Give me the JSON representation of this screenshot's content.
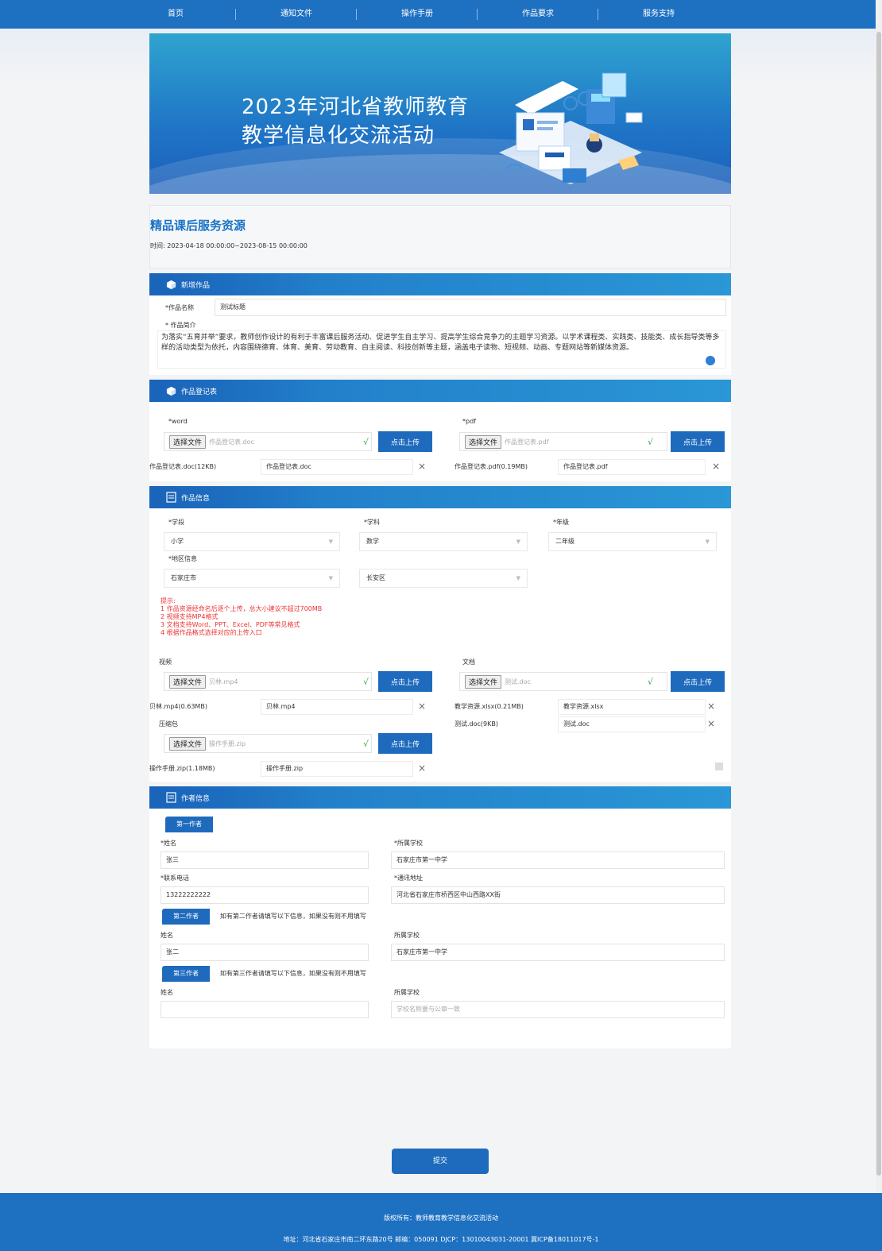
{
  "nav": [
    "首页",
    "通知文件",
    "操作手册",
    "作品要求",
    "服务支持"
  ],
  "banner": {
    "title1": "2023年河北省教师教育",
    "title2": "教学信息化交流活动"
  },
  "info": {
    "name": "精品课后服务资源",
    "time": "时间: 2023-04-18 00:00:00~2023-08-15 00:00:00"
  },
  "sections": {
    "new_work": "新增作品",
    "register": "作品登记表",
    "work_info": "作品信息",
    "author_info": "作者信息"
  },
  "work": {
    "name_label": "*作品名称",
    "name_value": "测试标题",
    "intro_label": "* 作品简介",
    "intro_text": "为落实“五育并举”要求，教师创作设计的有利于丰富课后服务活动、促进学生自主学习、提高学生综合竞争力的主题学习资源。以学术课程类、实践类、技能类、成长指导类等多样的活动类型为依托，内容围绕德育、体育、美育、劳动教育、自主阅读、科技创新等主题，涵盖电子读物、短视频、动画、专题网站等新媒体资源。"
  },
  "register": {
    "word_label": "*word",
    "pdf_label": "*pdf",
    "choose": "选择文件",
    "word_file": "作品登记表.doc",
    "pdf_file": "作品登记表.pdf",
    "upload": "点击上传",
    "check": "√",
    "word_uploaded": "作品登记表.doc(12KB)",
    "word_uploaded_name": "作品登记表.doc",
    "pdf_uploaded": "作品登记表.pdf(0.19MB)",
    "pdf_uploaded_name": "作品登记表.pdf",
    "x": "×"
  },
  "workinfo": {
    "stage_label": "*学段",
    "stage": "小学",
    "subject_label": "*学科",
    "subject": "数学",
    "grade_label": "*年级",
    "grade": "二年级",
    "region_label": "*地区信息",
    "city": "石家庄市",
    "district": "长安区",
    "hint": [
      "提示:",
      "1 作品资源经命名后逐个上传，总大小建议不超过700MB",
      "2 视频支持MP4格式",
      "3 文档支持Word、PPT、Excel、PDF等常见格式",
      "4 根据作品格式选择对应的上传入口"
    ],
    "video_label": "视频",
    "video_file": "贝林.mp4",
    "doc_label": "文档",
    "doc_file": "测试.doc",
    "video_uploaded": "贝林.mp4(0.63MB)",
    "video_uploaded_name": "贝林.mp4",
    "zip_label": "压缩包",
    "zip_file": "操作手册.zip",
    "zip_uploaded": "操作手册.zip(1.18MB)",
    "zip_uploaded_name": "操作手册.zip",
    "doc_uploaded1": "教学资源.xlsx(0.21MB)",
    "doc_uploaded1_name": "教学资源.xlsx",
    "doc_uploaded2": "测试.doc(9KB)",
    "doc_uploaded2_name": "测试.doc"
  },
  "authors": {
    "first": "第一作者",
    "second": "第二作者",
    "third": "第三作者",
    "optional_note2": "如有第二作者请填写以下信息，如果没有则不用填写",
    "optional_note3": "如有第三作者请填写以下信息，如果没有则不用填写",
    "name_req": "*姓名",
    "school_req": "*所属学校",
    "phone_req": "*联系电话",
    "addr_req": "*通讯地址",
    "name": "姓名",
    "school": "所属学校",
    "a1_name": "张三",
    "a1_school": "石家庄市第一中学",
    "a1_phone": "13222222222",
    "a1_addr": "河北省石家庄市桥西区中山西路XX街",
    "a2_name": "张二",
    "a2_school": "石家庄市第一中学",
    "a3_school_placeholder": "学校名称要与公章一致"
  },
  "submit": "提交",
  "footer": {
    "l1": "版权所有：教师教育教学信息化交流活动",
    "l2": "地址：河北省石家庄市南二环东路20号  邮编：050091  DJCP：13010043031-20001  冀ICP备18011017号-1"
  },
  "colors": {
    "primary": "#1e70c1",
    "hint": "#e33333",
    "check": "#2fae42"
  }
}
